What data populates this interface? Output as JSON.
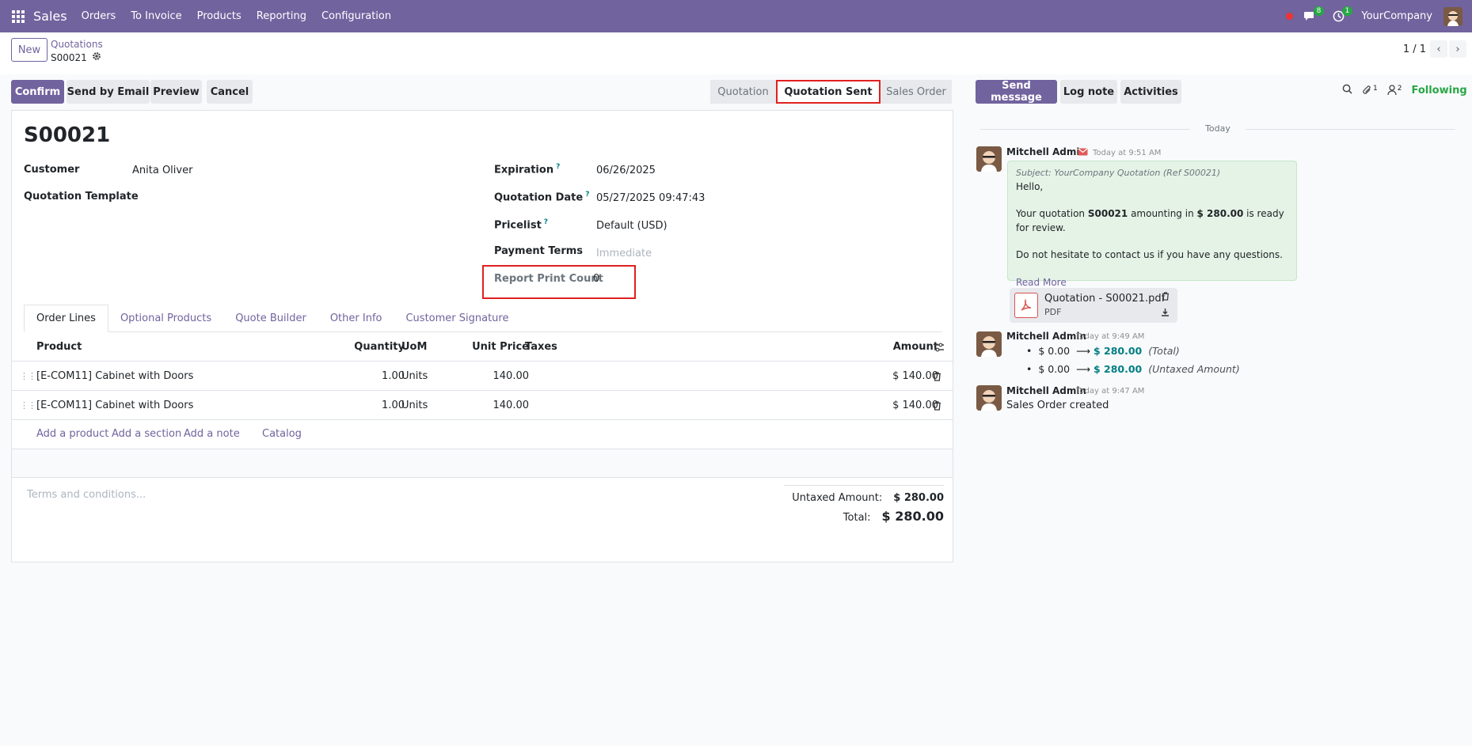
{
  "navbar": {
    "app_name": "Sales",
    "menu": [
      "Orders",
      "To Invoice",
      "Products",
      "Reporting",
      "Configuration"
    ],
    "messages_badge": "8",
    "activities_badge": "1",
    "company": "YourCompany"
  },
  "control": {
    "new_label": "New",
    "breadcrumb_parent": "Quotations",
    "breadcrumb_current": "S00021",
    "pager": "1 / 1"
  },
  "actions": {
    "confirm": "Confirm",
    "send_email": "Send by Email",
    "preview": "Preview",
    "cancel": "Cancel"
  },
  "statusbar": {
    "stages": [
      "Quotation",
      "Quotation Sent",
      "Sales Order"
    ],
    "active": "Quotation Sent"
  },
  "form": {
    "title": "S00021",
    "customer_label": "Customer",
    "customer_value": "Anita Oliver",
    "template_label": "Quotation Template",
    "expiration_label": "Expiration",
    "expiration_value": "06/26/2025",
    "qdate_label": "Quotation Date",
    "qdate_value": "05/27/2025 09:47:43",
    "pricelist_label": "Pricelist",
    "pricelist_value": "Default (USD)",
    "payment_label": "Payment Terms",
    "payment_placeholder": "Immediate",
    "print_count_label": "Report Print Count",
    "print_count_value": "0",
    "help_mark": "?"
  },
  "tabs": [
    "Order Lines",
    "Optional Products",
    "Quote Builder",
    "Other Info",
    "Customer Signature"
  ],
  "lines": {
    "headers": {
      "product": "Product",
      "quantity": "Quantity",
      "uom": "UoM",
      "unit_price": "Unit Price",
      "taxes": "Taxes",
      "amount": "Amount"
    },
    "rows": [
      {
        "product": "[E-COM11] Cabinet with Doors",
        "quantity": "1.00",
        "uom": "Units",
        "unit_price": "140.00",
        "amount": "$ 140.00"
      },
      {
        "product": "[E-COM11] Cabinet with Doors",
        "quantity": "1.00",
        "uom": "Units",
        "unit_price": "140.00",
        "amount": "$ 140.00"
      }
    ],
    "add_product": "Add a product",
    "add_section": "Add a section",
    "add_note": "Add a note",
    "catalog": "Catalog"
  },
  "footer": {
    "terms_placeholder": "Terms and conditions...",
    "untaxed_label": "Untaxed Amount:",
    "untaxed_value": "$ 280.00",
    "total_label": "Total:",
    "total_value": "$ 280.00"
  },
  "chatter": {
    "send_message": "Send message",
    "log_note": "Log note",
    "activities": "Activities",
    "attachments_count": "1",
    "followers_count": "2",
    "following": "Following",
    "today": "Today",
    "messages": [
      {
        "author": "Mitchell Admin",
        "time": "Today at 9:51 AM",
        "subject": "Subject: YourCompany Quotation (Ref S00021)",
        "greeting": "Hello,",
        "body_prefix": "Your quotation ",
        "body_ref": "S00021",
        "body_mid": " amounting in ",
        "body_amount": "$ 280.00",
        "body_suffix": " is ready for review.",
        "body_2": "Do not hesitate to contact us if you have any questions.",
        "read_more": "Read More",
        "attachment_name": "Quotation - S00021.pdf",
        "attachment_type": "PDF"
      },
      {
        "author": "Mitchell Admin",
        "time": "Today at 9:49 AM",
        "changes": [
          {
            "old": "$ 0.00",
            "new": "$ 280.00",
            "field": "(Total)"
          },
          {
            "old": "$ 0.00",
            "new": "$ 280.00",
            "field": "(Untaxed Amount)"
          }
        ]
      },
      {
        "author": "Mitchell Admin",
        "time": "Today at 9:47 AM",
        "body": "Sales Order created"
      }
    ]
  }
}
